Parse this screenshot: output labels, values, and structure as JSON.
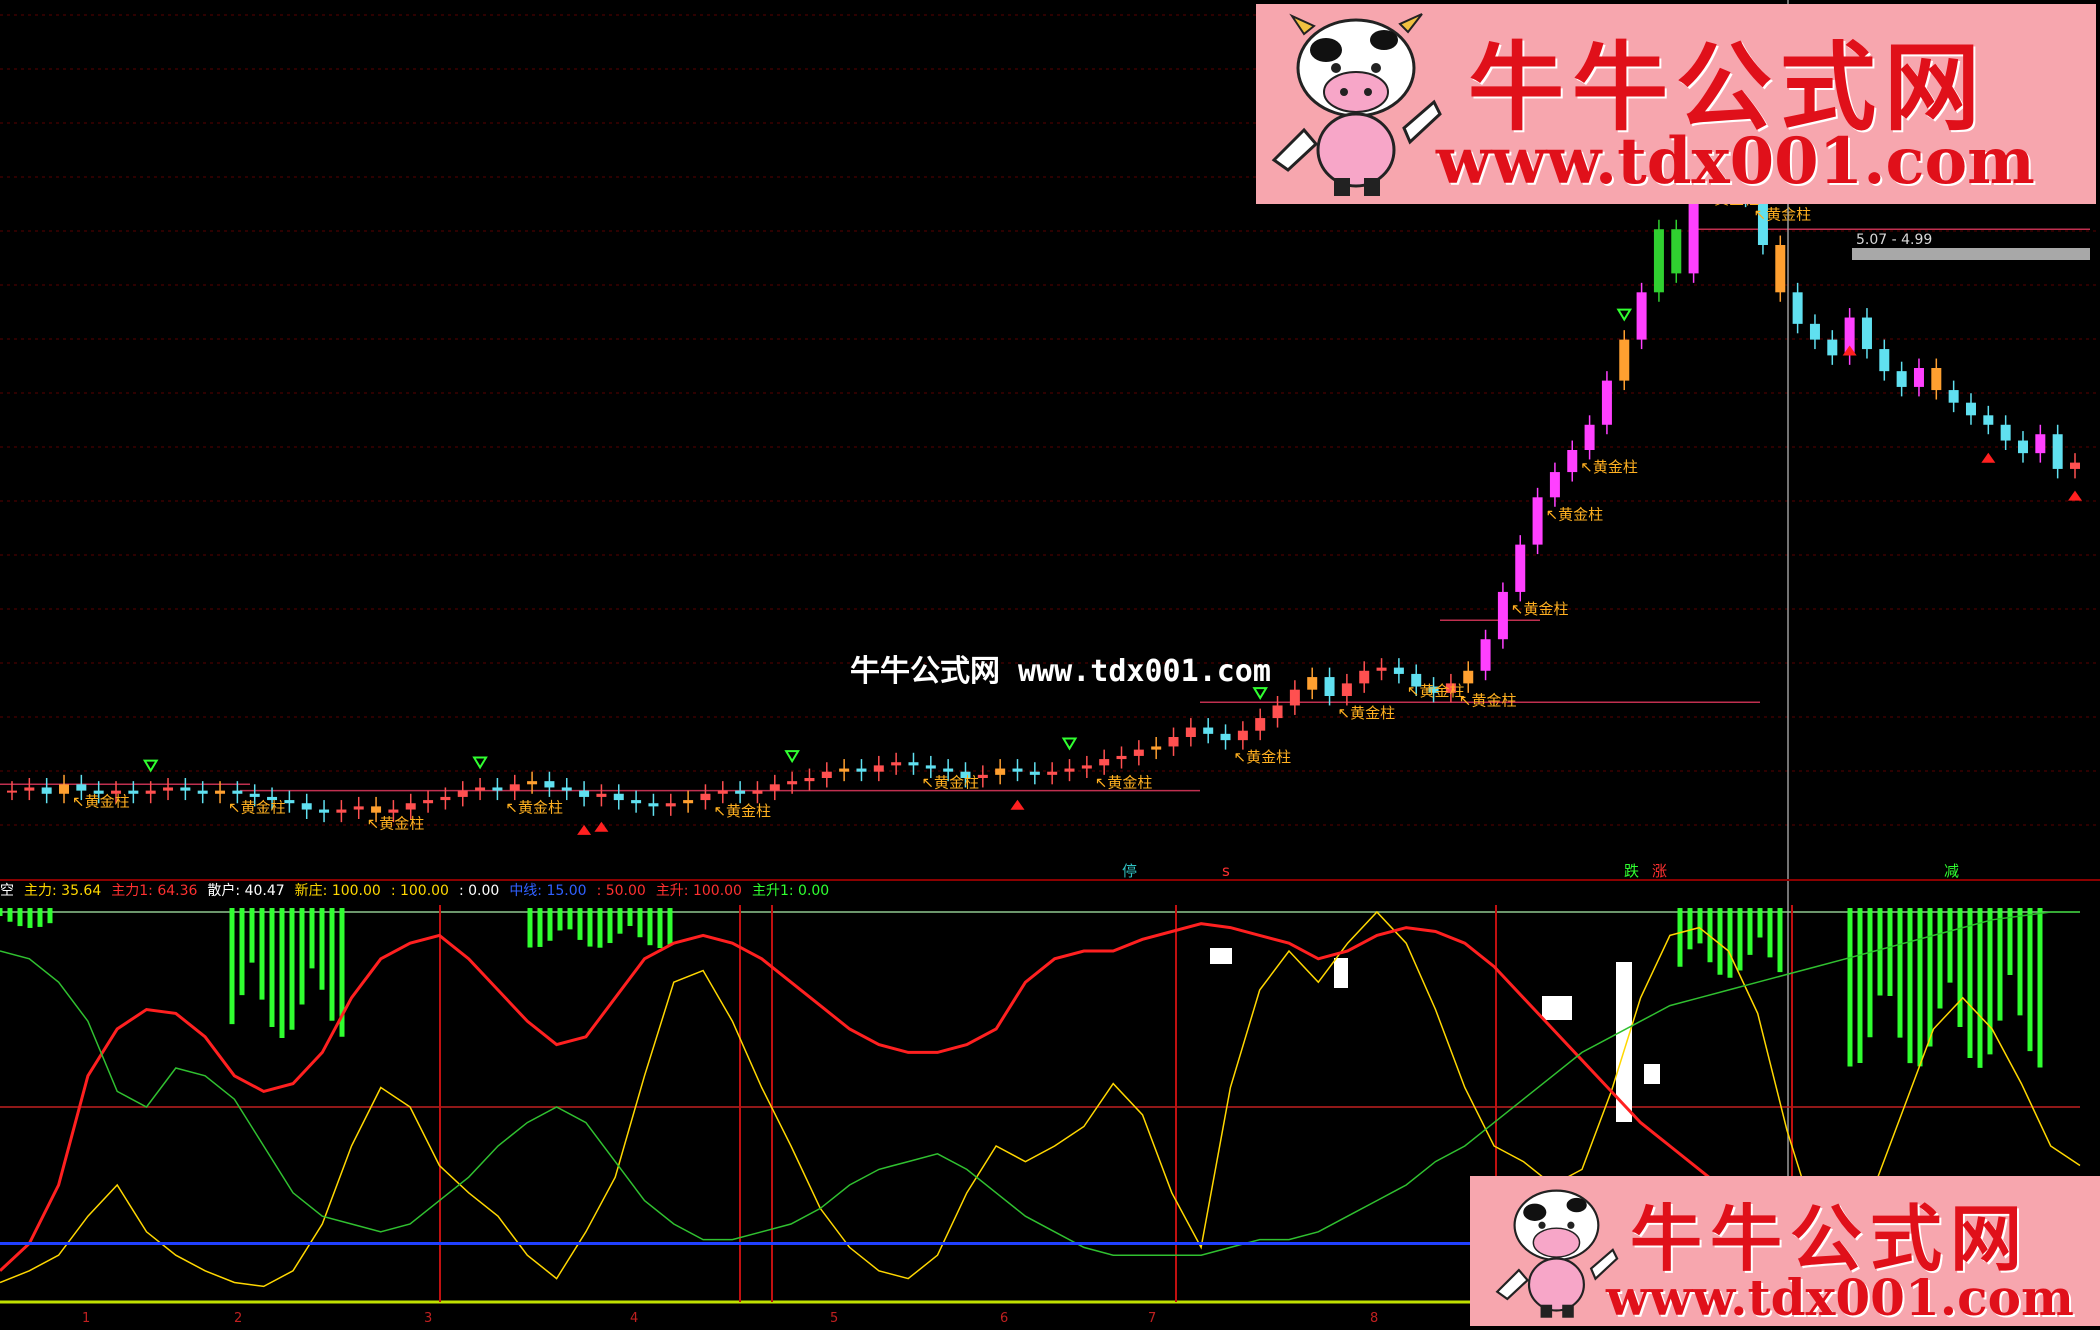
{
  "watermark": {
    "name": "牛牛公式网",
    "url": "www.tdx001.com",
    "center_text": "牛牛公式网 www.tdx001.com"
  },
  "price_panel": {
    "price_range_label": "5.07 - 4.99",
    "signal_label": "黄金柱",
    "bottom_markers": [
      "停",
      "s",
      "跌",
      "涨",
      "减"
    ]
  },
  "indicator_bar": {
    "items": [
      {
        "text": "空",
        "color": "#ffffff"
      },
      {
        "text": "主力: 35.64",
        "color": "#ffd700"
      },
      {
        "text": "主力1: 64.36",
        "color": "#ff3030"
      },
      {
        "text": "散户: 40.47",
        "color": "#ffffff"
      },
      {
        "text": "新庄: 100.00",
        "color": "#ffd700"
      },
      {
        "text": ": 100.00",
        "color": "#ffd700"
      },
      {
        "text": ": 0.00",
        "color": "#ffffff"
      },
      {
        "text": "中线: 15.00",
        "color": "#3060ff"
      },
      {
        "text": ": 50.00",
        "color": "#ff3030"
      },
      {
        "text": "主升: 100.00",
        "color": "#ff3030"
      },
      {
        "text": "主升1: 0.00",
        "color": "#30ff30"
      }
    ]
  },
  "x_ticks": [
    "1",
    "2",
    "3",
    "4",
    "5",
    "6",
    "7",
    "8"
  ],
  "chart_data": [
    {
      "type": "candlestick",
      "panel": "price",
      "values": [
        3.62,
        3.63,
        3.61,
        3.64,
        3.62,
        3.61,
        3.62,
        3.61,
        3.62,
        3.63,
        3.62,
        3.61,
        3.62,
        3.61,
        3.6,
        3.59,
        3.58,
        3.56,
        3.55,
        3.56,
        3.57,
        3.55,
        3.56,
        3.58,
        3.59,
        3.6,
        3.62,
        3.63,
        3.62,
        3.64,
        3.65,
        3.63,
        3.62,
        3.6,
        3.61,
        3.59,
        3.58,
        3.57,
        3.58,
        3.59,
        3.61,
        3.62,
        3.61,
        3.62,
        3.64,
        3.65,
        3.66,
        3.68,
        3.69,
        3.68,
        3.7,
        3.71,
        3.7,
        3.69,
        3.68,
        3.66,
        3.67,
        3.69,
        3.68,
        3.67,
        3.68,
        3.69,
        3.7,
        3.72,
        3.73,
        3.75,
        3.76,
        3.79,
        3.82,
        3.8,
        3.78,
        3.81,
        3.85,
        3.89,
        3.94,
        3.98,
        3.92,
        3.96,
        4.0,
        4.01,
        3.99,
        3.95,
        3.93,
        3.96,
        4.0,
        4.1,
        4.25,
        4.4,
        4.55,
        4.63,
        4.7,
        4.78,
        4.92,
        5.05,
        5.2,
        5.4,
        5.26,
        5.55,
        5.85,
        5.7,
        5.5,
        5.35,
        5.2,
        5.1,
        5.05,
        5.0,
        5.12,
        5.02,
        4.95,
        4.9,
        4.96,
        4.89,
        4.85,
        4.81,
        4.78,
        4.73,
        4.69,
        4.75,
        4.64,
        4.66
      ]
    },
    {
      "type": "line",
      "panel": "indicator",
      "series": [
        {
          "name": "主力",
          "color": "#ffd700",
          "values": [
            5,
            8,
            12,
            22,
            30,
            18,
            12,
            8,
            5,
            4,
            8,
            20,
            40,
            55,
            50,
            35,
            28,
            22,
            12,
            6,
            18,
            32,
            58,
            82,
            85,
            72,
            55,
            40,
            24,
            14,
            8,
            6,
            12,
            28,
            40,
            36,
            40,
            45,
            56,
            48,
            28,
            14,
            55,
            80,
            90,
            82,
            92,
            100,
            92,
            75,
            55,
            40,
            36,
            30,
            34,
            54,
            78,
            94,
            96,
            90,
            74,
            44,
            20,
            16,
            30,
            50,
            70,
            78,
            70,
            56,
            40,
            35
          ]
        },
        {
          "name": "主力1",
          "color": "#ff2020",
          "values": [
            8,
            15,
            30,
            58,
            70,
            75,
            74,
            68,
            58,
            54,
            56,
            64,
            78,
            88,
            92,
            94,
            88,
            80,
            72,
            66,
            68,
            78,
            88,
            92,
            94,
            92,
            88,
            82,
            76,
            70,
            66,
            64,
            64,
            66,
            70,
            82,
            88,
            90,
            90,
            93,
            95,
            97,
            96,
            94,
            92,
            88,
            90,
            94,
            96,
            95,
            92,
            86,
            78,
            70,
            62,
            54,
            46,
            40,
            34,
            28,
            22,
            16,
            12,
            10,
            8,
            6,
            5,
            4,
            4,
            4,
            4,
            4
          ]
        },
        {
          "name": "散户",
          "color": "#30c030",
          "values": [
            90,
            88,
            82,
            72,
            54,
            50,
            60,
            58,
            52,
            40,
            28,
            22,
            20,
            18,
            20,
            26,
            32,
            40,
            46,
            50,
            46,
            36,
            26,
            20,
            16,
            16,
            18,
            20,
            24,
            30,
            34,
            36,
            38,
            34,
            28,
            22,
            18,
            14,
            12,
            12,
            12,
            12,
            14,
            16,
            16,
            18,
            22,
            26,
            30,
            36,
            40,
            46,
            52,
            58,
            64,
            68,
            72,
            76,
            78,
            80,
            82,
            84,
            86,
            88,
            90,
            92,
            94,
            96,
            98,
            99,
            100,
            100
          ]
        },
        {
          "name": "中线",
          "color": "#2040ff",
          "values": [
            15,
            15,
            15,
            15,
            15,
            15,
            15,
            15,
            15,
            15,
            15,
            15,
            15,
            15,
            15,
            15,
            15,
            15,
            15,
            15,
            15,
            15,
            15,
            15,
            15,
            15,
            15,
            15,
            15,
            15,
            15,
            15,
            15,
            15,
            15,
            15,
            15,
            15,
            15,
            15,
            15,
            15,
            15,
            15,
            15,
            15,
            15,
            15,
            15,
            15,
            15,
            15,
            15,
            15,
            15,
            15,
            15,
            15,
            15,
            15,
            15,
            15,
            15,
            15,
            15,
            15,
            15,
            15,
            15,
            15,
            15,
            15
          ]
        }
      ],
      "reference_lines": [
        50,
        100,
        0
      ]
    }
  ]
}
